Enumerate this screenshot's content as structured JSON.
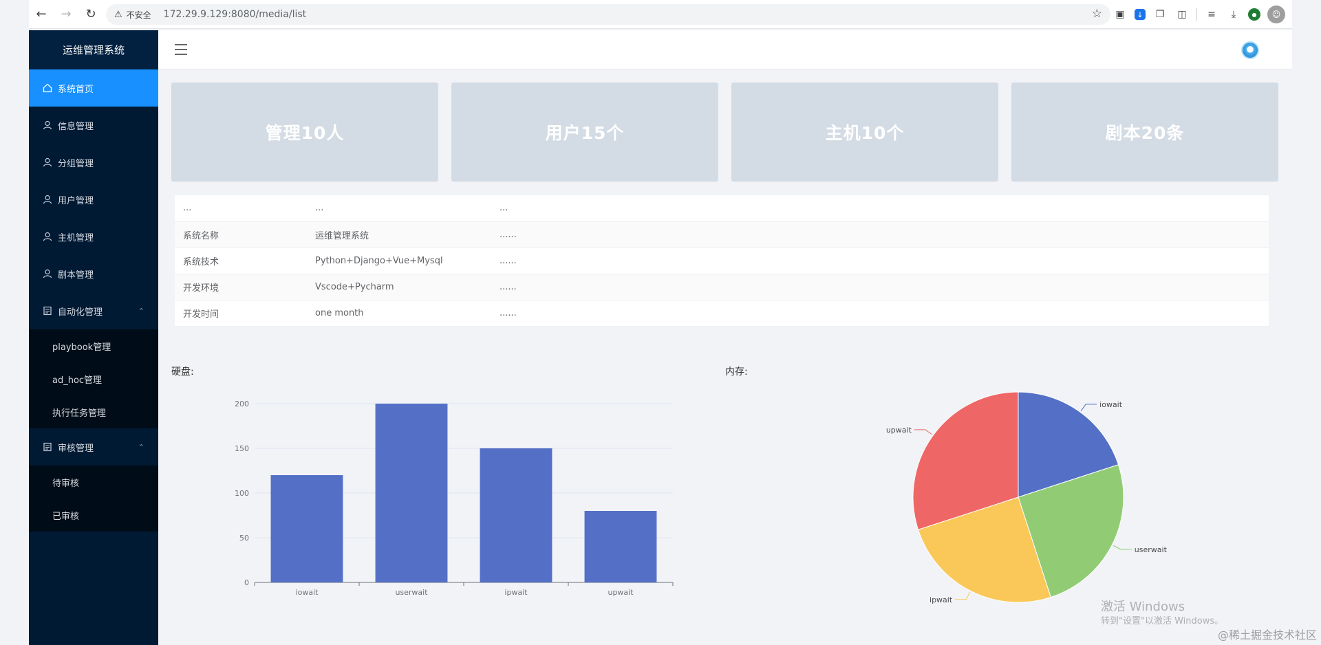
{
  "browser": {
    "insecure_label": "不安全",
    "url": "172.29.9.129:8080/media/list"
  },
  "sidebar": {
    "brand": "运维管理系统",
    "items": [
      {
        "label": "系统首页",
        "icon": "home-icon"
      },
      {
        "label": "信息管理",
        "icon": "user-icon"
      },
      {
        "label": "分组管理",
        "icon": "user-icon"
      },
      {
        "label": "用户管理",
        "icon": "user-icon"
      },
      {
        "label": "主机管理",
        "icon": "user-icon"
      },
      {
        "label": "剧本管理",
        "icon": "user-icon"
      }
    ],
    "automation": {
      "label": "自动化管理",
      "subitems": [
        "playbook管理",
        "ad_hoc管理",
        "执行任务管理"
      ]
    },
    "review": {
      "label": "审核管理",
      "subitems": [
        "待审核",
        "已审核"
      ]
    }
  },
  "cards": [
    "管理10人",
    "用户15个",
    "主机10个",
    "剧本20条"
  ],
  "table": {
    "rows": [
      [
        "...",
        "...",
        "..."
      ],
      [
        "系统名称",
        "运维管理系统",
        "......"
      ],
      [
        "系统技术",
        "Python+Django+Vue+Mysql",
        "......"
      ],
      [
        "开发环境",
        "Vscode+Pycharm",
        "......"
      ],
      [
        "开发时间",
        "one month",
        "......"
      ]
    ]
  },
  "disk_label": "硬盘:",
  "memory_label": "内存:",
  "chart_data": [
    {
      "type": "bar",
      "categories": [
        "iowait",
        "userwait",
        "ipwait",
        "upwait"
      ],
      "values": [
        120,
        200,
        150,
        80
      ],
      "ylim": [
        0,
        200
      ],
      "yticks": [
        0,
        50,
        100,
        150,
        200
      ],
      "color": "#5470c6",
      "grid": true
    },
    {
      "type": "pie",
      "labels": [
        "iowait",
        "userwait",
        "ipwait",
        "upwait"
      ],
      "values": [
        20,
        25,
        25,
        30
      ],
      "colors": [
        "#5470c6",
        "#91cc75",
        "#fac858",
        "#ee6666"
      ]
    }
  ],
  "watermark": {
    "line1": "激活 Windows",
    "line2": "转到\"设置\"以激活 Windows。",
    "credit": "@稀土掘金技术社区"
  }
}
